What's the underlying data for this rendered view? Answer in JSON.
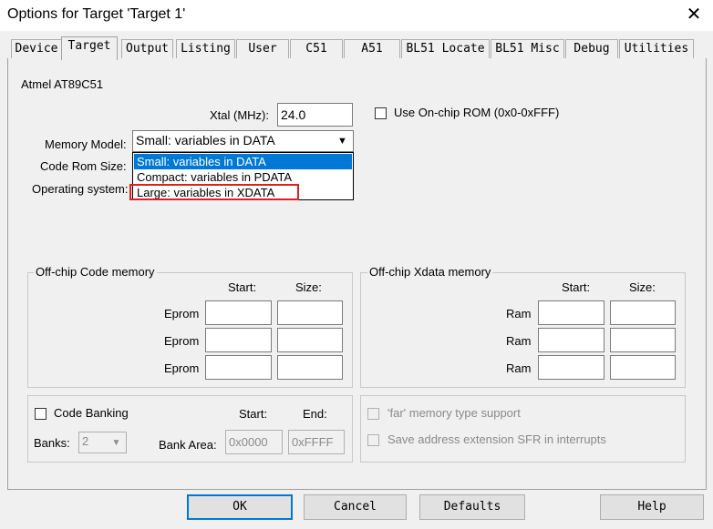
{
  "window": {
    "title": "Options for Target 'Target 1'"
  },
  "tabs": [
    {
      "label": "Device"
    },
    {
      "label": "Target",
      "active": true
    },
    {
      "label": "Output"
    },
    {
      "label": "Listing"
    },
    {
      "label": "User"
    },
    {
      "label": "C51"
    },
    {
      "label": "A51"
    },
    {
      "label": "BL51 Locate"
    },
    {
      "label": "BL51 Misc"
    },
    {
      "label": "Debug"
    },
    {
      "label": "Utilities"
    }
  ],
  "device_name": "Atmel AT89C51",
  "xtal": {
    "label": "Xtal (MHz):",
    "value": "24.0"
  },
  "onchip_rom": {
    "label": "Use On-chip ROM (0x0-0xFFF)",
    "checked": false
  },
  "memory_model": {
    "label": "Memory Model:",
    "selected": "Small: variables in DATA",
    "options": [
      "Small: variables in DATA",
      "Compact: variables in PDATA",
      "Large: variables in XDATA"
    ]
  },
  "code_rom_size": {
    "label": "Code Rom Size:"
  },
  "operating_system": {
    "label": "Operating system:"
  },
  "code_memory": {
    "legend": "Off-chip Code memory",
    "start_header": "Start:",
    "size_header": "Size:",
    "rows": [
      {
        "label": "Eprom"
      },
      {
        "label": "Eprom"
      },
      {
        "label": "Eprom"
      }
    ]
  },
  "xdata_memory": {
    "legend": "Off-chip Xdata memory",
    "start_header": "Start:",
    "size_header": "Size:",
    "rows": [
      {
        "label": "Ram"
      },
      {
        "label": "Ram"
      },
      {
        "label": "Ram"
      }
    ]
  },
  "banking": {
    "label": "Code Banking",
    "checked": false,
    "banks_label": "Banks:",
    "banks_value": "2",
    "bank_area_label": "Bank Area:",
    "start_header": "Start:",
    "end_header": "End:",
    "start_value": "0x0000",
    "end_value": "0xFFFF"
  },
  "far_memory": {
    "label": "'far' memory type support"
  },
  "save_sfr": {
    "label": "Save address extension SFR in interrupts"
  },
  "buttons": {
    "ok": "OK",
    "cancel": "Cancel",
    "defaults": "Defaults",
    "help": "Help"
  }
}
